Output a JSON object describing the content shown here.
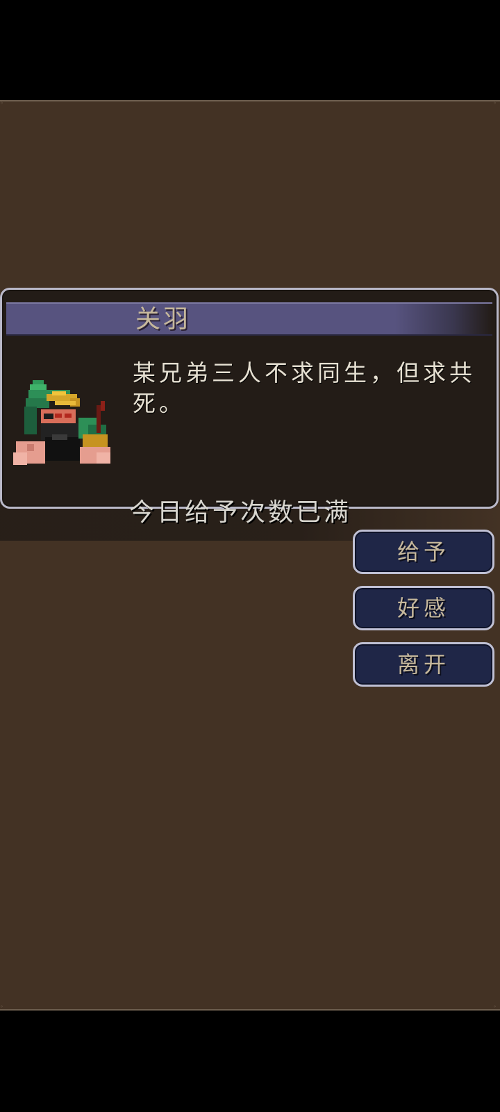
{
  "dialog": {
    "speaker_name": "关羽",
    "message": "某兄弟三人不求同生，但求共死。",
    "portrait_icon": "guan-yu-pixel-portrait"
  },
  "notice": {
    "text": "今日给予次数已满"
  },
  "menu": {
    "buttons": [
      {
        "label": "给予"
      },
      {
        "label": "好感"
      },
      {
        "label": "离开"
      }
    ]
  },
  "colors": {
    "background": "#433224",
    "panel": "#231c17",
    "name_banner": "#57537f",
    "button_fill": "#1f2647",
    "button_border": "#bfc0d4",
    "label_gold": "#c6b89c"
  }
}
